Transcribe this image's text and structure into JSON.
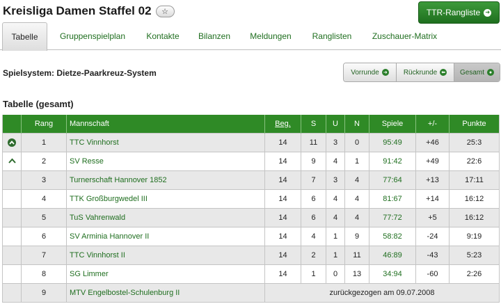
{
  "header": {
    "title": "Kreisliga Damen Staffel 02",
    "star_icon": "star-icon",
    "ttr_button_label": "TTR-Rangliste",
    "ttr_icon": "circle-arrow-right-icon"
  },
  "tabs": [
    {
      "label": "Tabelle",
      "active": true
    },
    {
      "label": "Gruppenspielplan",
      "active": false
    },
    {
      "label": "Kontakte",
      "active": false
    },
    {
      "label": "Bilanzen",
      "active": false
    },
    {
      "label": "Meldungen",
      "active": false
    },
    {
      "label": "Ranglisten",
      "active": false
    },
    {
      "label": "Zuschauer-Matrix",
      "active": false
    }
  ],
  "system_label": "Spielsystem: Dietze-Paarkreuz-System",
  "round_selector": [
    {
      "label": "Vorrunde",
      "icon": "circle-arrow-right-icon",
      "active": false
    },
    {
      "label": "Rückrunde",
      "icon": "circle-arrow-left-icon",
      "active": false
    },
    {
      "label": "Gesamt",
      "icon": "circle-dot-icon",
      "active": true
    }
  ],
  "section_title": "Tabelle (gesamt)",
  "table": {
    "columns": [
      "",
      "Rang",
      "Mannschaft",
      "Beg.",
      "S",
      "U",
      "N",
      "Spiele",
      "+/-",
      "Punkte"
    ],
    "rows": [
      {
        "indicator": "promotion-circle",
        "rank": "1",
        "team": "TTC Vinnhorst",
        "beg": "14",
        "s": "11",
        "u": "3",
        "n": "0",
        "games": "95:49",
        "diff": "+46",
        "points": "25:3"
      },
      {
        "indicator": "promotion-arrow",
        "rank": "2",
        "team": "SV Resse",
        "beg": "14",
        "s": "9",
        "u": "4",
        "n": "1",
        "games": "91:42",
        "diff": "+49",
        "points": "22:6"
      },
      {
        "indicator": "",
        "rank": "3",
        "team": "Turnerschaft Hannover 1852",
        "beg": "14",
        "s": "7",
        "u": "3",
        "n": "4",
        "games": "77:64",
        "diff": "+13",
        "points": "17:11"
      },
      {
        "indicator": "",
        "rank": "4",
        "team": "TTK Großburgwedel III",
        "beg": "14",
        "s": "6",
        "u": "4",
        "n": "4",
        "games": "81:67",
        "diff": "+14",
        "points": "16:12"
      },
      {
        "indicator": "",
        "rank": "5",
        "team": "TuS Vahrenwald",
        "beg": "14",
        "s": "6",
        "u": "4",
        "n": "4",
        "games": "77:72",
        "diff": "+5",
        "points": "16:12"
      },
      {
        "indicator": "",
        "rank": "6",
        "team": "SV Arminia Hannover II",
        "beg": "14",
        "s": "4",
        "u": "1",
        "n": "9",
        "games": "58:82",
        "diff": "-24",
        "points": "9:19"
      },
      {
        "indicator": "",
        "rank": "7",
        "team": "TTC Vinnhorst II",
        "beg": "14",
        "s": "2",
        "u": "1",
        "n": "11",
        "games": "46:89",
        "diff": "-43",
        "points": "5:23"
      },
      {
        "indicator": "",
        "rank": "8",
        "team": "SG Limmer",
        "beg": "14",
        "s": "1",
        "u": "0",
        "n": "13",
        "games": "34:94",
        "diff": "-60",
        "points": "2:26"
      }
    ],
    "withdrawn": {
      "rank": "9",
      "team": "MTV Engelbostel-Schulenburg II",
      "note": "zurückgezogen am 09.07.2008"
    }
  },
  "colors": {
    "header_green": "#2f8a26",
    "link_green": "#1f6e1f",
    "row_alt": "#e8e8e8"
  }
}
